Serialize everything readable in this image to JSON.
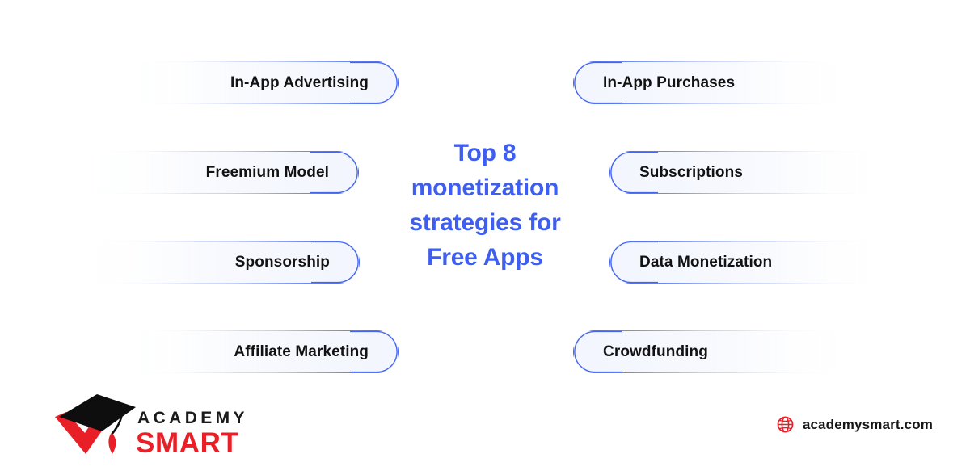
{
  "title": {
    "lines": [
      "Top 8",
      "monetization",
      "strategies for",
      "Free Apps"
    ],
    "full_text": "Top 8 monetization strategies for Free Apps",
    "color": "#3D5EF0"
  },
  "strategies": {
    "count": 8,
    "left_column": [
      {
        "label": "In-App Advertising"
      },
      {
        "label": "Freemium Model"
      },
      {
        "label": "Sponsorship"
      },
      {
        "label": "Affiliate Marketing"
      }
    ],
    "right_column": [
      {
        "label": "In-App Purchases"
      },
      {
        "label": "Subscriptions"
      },
      {
        "label": "Data Monetization"
      },
      {
        "label": "Crowdfunding"
      }
    ]
  },
  "logo": {
    "word_top": "ACADEMY",
    "word_bottom": "SMART",
    "cap_icon": "graduation-cap-icon",
    "check_icon": "red-checkmark-icon",
    "colors": {
      "cap": "#0E0E0E",
      "accent": "#E81F27"
    }
  },
  "footer": {
    "website": "academysmart.com",
    "globe_icon": "globe-icon",
    "globe_color": "#E81F27"
  },
  "theme": {
    "background": "#FFFFFF",
    "pill_border": "#4466EE",
    "pill_fill": "#F4F7FE",
    "text": "#121212",
    "accent_blue": "#3D5EF0",
    "accent_red": "#E81F27"
  }
}
